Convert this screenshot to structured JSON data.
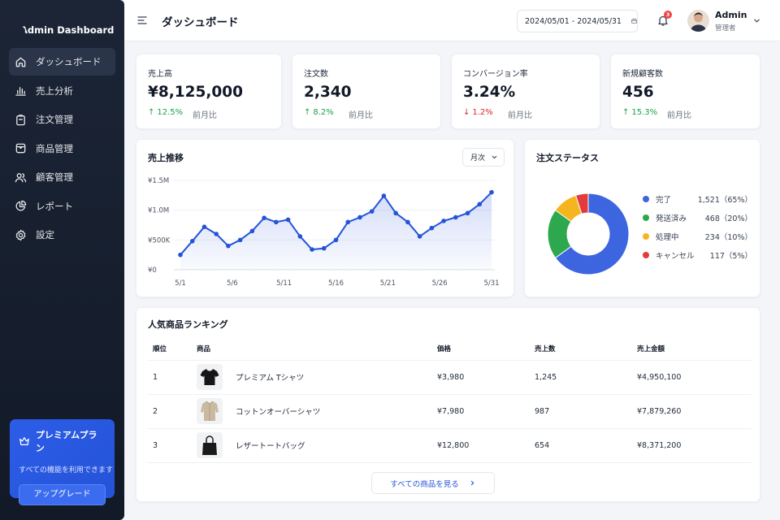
{
  "app": {
    "brand_name": "Admin Dashboard"
  },
  "sidebar": {
    "items": [
      {
        "label": "ダッシュボード",
        "icon": "home-icon",
        "active": true
      },
      {
        "label": "売上分析",
        "icon": "bar-chart-icon",
        "active": false
      },
      {
        "label": "注文管理",
        "icon": "clipboard-icon",
        "active": false
      },
      {
        "label": "商品管理",
        "icon": "box-icon",
        "active": false
      },
      {
        "label": "顧客管理",
        "icon": "users-icon",
        "active": false
      },
      {
        "label": "レポート",
        "icon": "pie-chart-icon",
        "active": false
      },
      {
        "label": "設定",
        "icon": "gear-icon",
        "active": false
      }
    ],
    "promo": {
      "title": "プレミアムプラン",
      "description": "すべての機能を利用できます",
      "button_label": "アップグレード"
    }
  },
  "header": {
    "title": "ダッシュボード",
    "date_range": "2024/05/01 - 2024/05/31",
    "notification_count": "3",
    "user": {
      "name": "Admin",
      "role": "管理者"
    }
  },
  "kpis": [
    {
      "label": "売上高",
      "value": "¥8,125,000",
      "change": "12.5%",
      "direction": "up",
      "compare": "前月比"
    },
    {
      "label": "注文数",
      "value": "2,340",
      "change": "8.2%",
      "direction": "up",
      "compare": "前月比"
    },
    {
      "label": "コンバージョン率",
      "value": "3.24%",
      "change": "1.2%",
      "direction": "down",
      "compare": "前月比"
    },
    {
      "label": "新規顧客数",
      "value": "456",
      "change": "15.3%",
      "direction": "up",
      "compare": "前月比"
    }
  ],
  "sales_chart": {
    "title": "売上推移",
    "period": "月次",
    "chart_data": {
      "type": "area",
      "x_tick_labels": [
        "5/1",
        "5/6",
        "5/11",
        "5/16",
        "5/21",
        "5/26",
        "5/31"
      ],
      "y_tick_labels": [
        "¥0",
        "¥500K",
        "¥1.0M",
        "¥1.5M"
      ],
      "ylim": [
        0,
        1500000
      ],
      "x": [
        1,
        2,
        3,
        4,
        5,
        6,
        7,
        8,
        9,
        10,
        11,
        12,
        13,
        14,
        15,
        16,
        17,
        18,
        19,
        20,
        21,
        22,
        23,
        24,
        25,
        26,
        27,
        28,
        29,
        30,
        31
      ],
      "values": [
        250000,
        480000,
        720000,
        600000,
        400000,
        500000,
        650000,
        870000,
        800000,
        840000,
        560000,
        340000,
        360000,
        500000,
        800000,
        880000,
        980000,
        1240000,
        950000,
        800000,
        560000,
        700000,
        820000,
        880000,
        950000,
        1100000,
        1300000
      ],
      "grid": true,
      "color": "#2453d8"
    }
  },
  "order_status": {
    "title": "注文ステータス",
    "chart_data": {
      "type": "pie",
      "labels": [
        "完了",
        "発送済み",
        "処理中",
        "キャンセル"
      ],
      "values": [
        1521,
        468,
        234,
        117
      ],
      "display": [
        "1,521（65%）",
        "468（20%）",
        "234（10%）",
        "117（5%）"
      ],
      "colors": [
        "#3d65e0",
        "#2ea84f",
        "#f6b51e",
        "#e23b3b"
      ]
    }
  },
  "ranking": {
    "title": "人気商品ランキング",
    "columns": [
      "順位",
      "商品",
      "価格",
      "売上数",
      "売上金額"
    ],
    "rows": [
      {
        "rank": "1",
        "product": "プレミアム Tシャツ",
        "thumb": "tshirt-icon",
        "price": "¥3,980",
        "units": "1,245",
        "revenue": "¥4,950,100"
      },
      {
        "rank": "2",
        "product": "コットンオーバーシャツ",
        "thumb": "shirt-icon",
        "price": "¥7,980",
        "units": "987",
        "revenue": "¥7,879,260"
      },
      {
        "rank": "3",
        "product": "レザートートバッグ",
        "thumb": "bag-icon",
        "price": "¥12,800",
        "units": "654",
        "revenue": "¥8,371,200"
      }
    ],
    "view_all_label": "すべての商品を見る"
  }
}
